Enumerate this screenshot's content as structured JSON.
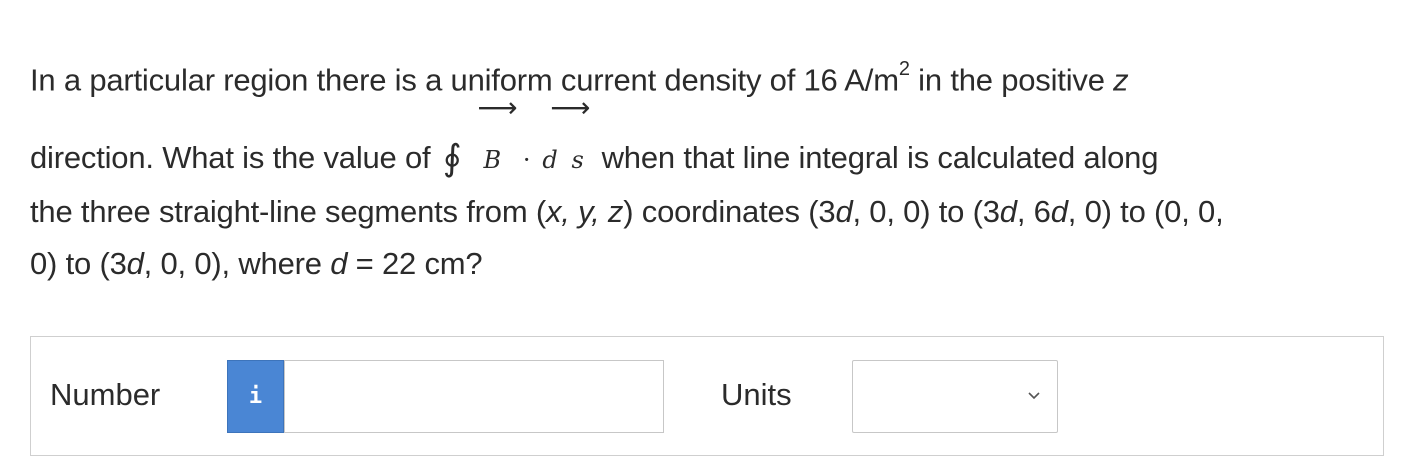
{
  "question": {
    "line1_pre": "In a particular region there is a uniform current density of 16 A/m",
    "line1_sup": "2",
    "line1_post": " in the positive ",
    "line1_var": "z",
    "line2_pre": "direction. What is the value of ",
    "integral_symbol": "∮",
    "vec_B": "B",
    "dot": "·",
    "vec_d": "d",
    "vec_s": "s",
    "arrow": "⟶",
    "line2_post": "when that line integral is calculated along",
    "line3_pre": "the three straight-line segments from (",
    "line3_xyz": "x, y, z",
    "line3_mid1": ") coordinates (3",
    "d1": "d",
    "line3_mid2": ", 0, 0) to (3",
    "d2": "d",
    "line3_mid3": ", 6",
    "d3": "d",
    "line3_end": ", 0) to (0, 0,",
    "line4_pre": "0) to (3",
    "d4": "d",
    "line4_mid": ", 0, 0), where ",
    "d5": "d",
    "line4_end": " = 22 cm?"
  },
  "answer": {
    "number_label": "Number",
    "info_icon": "i",
    "number_value": "",
    "units_label": "Units",
    "units_selected": ""
  },
  "icons": {
    "info": "info-icon",
    "select": "chevron-down-icon"
  },
  "colors": {
    "info_button": "#4a86d4",
    "text": "#2b2b2b",
    "border": "#cfcfcf"
  }
}
